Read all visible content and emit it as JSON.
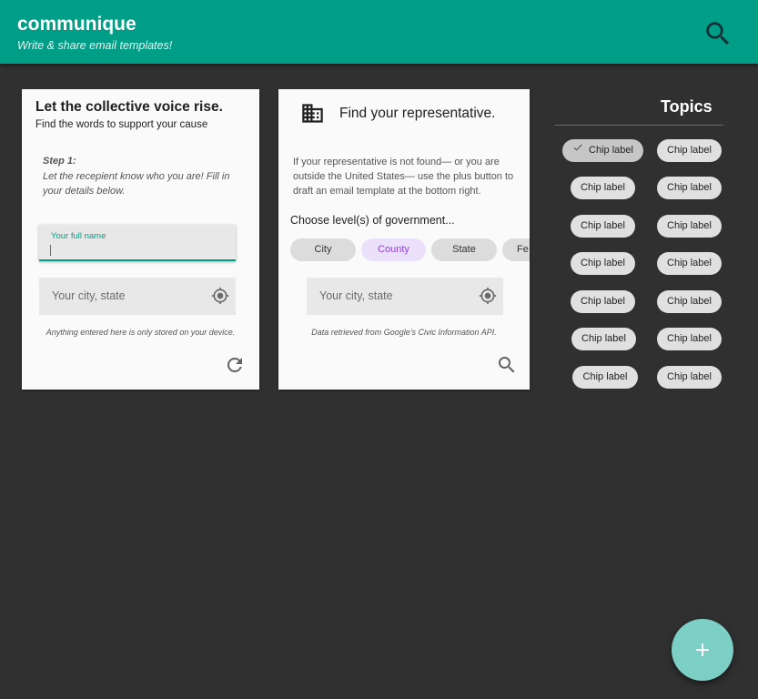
{
  "app": {
    "title": "communique",
    "subtitle": "Write & share email templates!",
    "search_icon": "search-icon",
    "accent_color": "#009e86"
  },
  "identity_card": {
    "title": "Let the collective voice rise.",
    "subtitle": "Find the words to support your cause",
    "step_label": "Step 1:",
    "instructions": "Let the recepient know who you are! Fill in your details below.",
    "name_field": {
      "label": "Your full name",
      "value": ""
    },
    "city_field": {
      "placeholder": "Your city, state",
      "icon": "my-location-icon"
    },
    "footnote": "Anything entered here is only stored on your device.",
    "reset_icon": "refresh-icon"
  },
  "rep_card": {
    "icon": "building-icon",
    "title": "Find your representative.",
    "description": "If your representative is not found— or you are outside the United States— use the plus button to draft an email template at the bottom right.",
    "choose_label": "Choose level(s) of government...",
    "levels": [
      "City",
      "County",
      "State",
      "Fe"
    ],
    "selected_level": "County",
    "city_field": {
      "placeholder": "Your city, state",
      "icon": "my-location-icon"
    },
    "footnote": "Data retrieved from Google's Civic Information API.",
    "search_icon": "search-icon"
  },
  "topics": {
    "title": "Topics",
    "chips": [
      {
        "label": "Chip label",
        "checked": true
      },
      {
        "label": "Chip label",
        "checked": false
      },
      {
        "label": "Chip label",
        "checked": false
      },
      {
        "label": "Chip label",
        "checked": false
      },
      {
        "label": "Chip label",
        "checked": false
      },
      {
        "label": "Chip label",
        "checked": false
      },
      {
        "label": "Chip label",
        "checked": false
      },
      {
        "label": "Chip label",
        "checked": false
      },
      {
        "label": "Chip label",
        "checked": false
      },
      {
        "label": "Chip label",
        "checked": false
      },
      {
        "label": "Chip label",
        "checked": false
      },
      {
        "label": "Chip label",
        "checked": false
      },
      {
        "label": "Chip label",
        "checked": false
      },
      {
        "label": "Chip label",
        "checked": false
      }
    ]
  },
  "fab": {
    "icon": "plus-icon"
  }
}
